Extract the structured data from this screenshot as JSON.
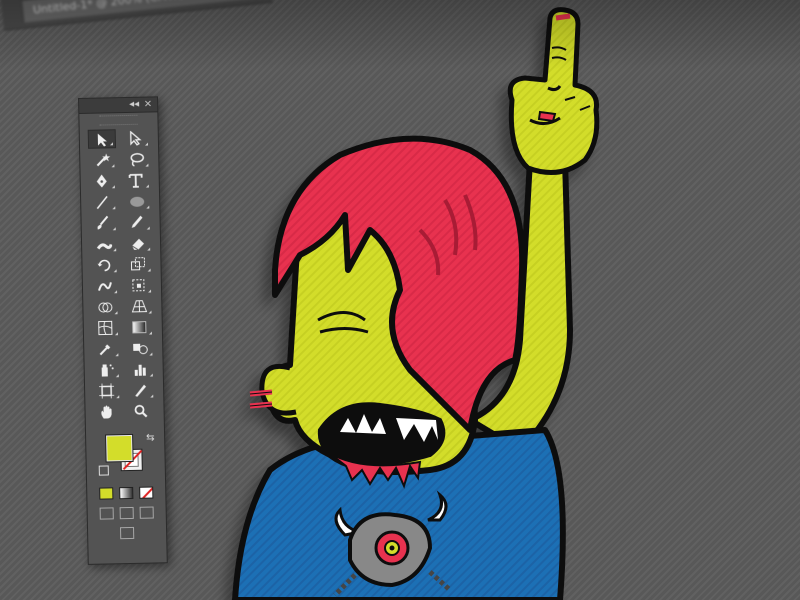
{
  "window": {
    "document_tab_title": "Untitled-1* @ 200% (CMYK/Preview)",
    "close_glyph": "×"
  },
  "tools_panel": {
    "collapse_glyph": "◂◂",
    "close_glyph": "×",
    "tools": [
      {
        "name": "selection-tool",
        "icon": "arrow-pointer",
        "active": true
      },
      {
        "name": "direct-selection-tool",
        "icon": "white-arrow"
      },
      {
        "name": "magic-wand-tool",
        "icon": "magic-wand"
      },
      {
        "name": "lasso-tool",
        "icon": "lasso"
      },
      {
        "name": "pen-tool",
        "icon": "pen-nib"
      },
      {
        "name": "type-tool",
        "icon": "T"
      },
      {
        "name": "line-segment-tool",
        "icon": "line"
      },
      {
        "name": "ellipse-tool",
        "icon": "ellipse"
      },
      {
        "name": "paintbrush-tool",
        "icon": "brush"
      },
      {
        "name": "pencil-tool",
        "icon": "pencil"
      },
      {
        "name": "blob-brush-tool",
        "icon": "blob-brush"
      },
      {
        "name": "eraser-tool",
        "icon": "eraser"
      },
      {
        "name": "rotate-tool",
        "icon": "rotate"
      },
      {
        "name": "scale-tool",
        "icon": "scale"
      },
      {
        "name": "warp-tool",
        "icon": "warp"
      },
      {
        "name": "free-transform-tool",
        "icon": "free-transform"
      },
      {
        "name": "shape-builder-tool",
        "icon": "shape-builder"
      },
      {
        "name": "perspective-grid-tool",
        "icon": "perspective-grid"
      },
      {
        "name": "mesh-tool",
        "icon": "mesh"
      },
      {
        "name": "gradient-tool",
        "icon": "gradient"
      },
      {
        "name": "eyedropper-tool",
        "icon": "eyedropper"
      },
      {
        "name": "blend-tool",
        "icon": "blend"
      },
      {
        "name": "symbol-sprayer-tool",
        "icon": "symbol-sprayer"
      },
      {
        "name": "column-graph-tool",
        "icon": "column-graph"
      },
      {
        "name": "artboard-tool",
        "icon": "artboard"
      },
      {
        "name": "slice-tool",
        "icon": "slice"
      },
      {
        "name": "hand-tool",
        "icon": "hand"
      },
      {
        "name": "zoom-tool",
        "icon": "magnifier"
      }
    ],
    "fill_color": "#d3dd2a",
    "stroke": "none"
  },
  "artwork": {
    "skin_color": "#d3dd2a",
    "hair_color": "#e8304f",
    "shirt_color": "#1f6fb5",
    "outline_color": "#111111"
  }
}
